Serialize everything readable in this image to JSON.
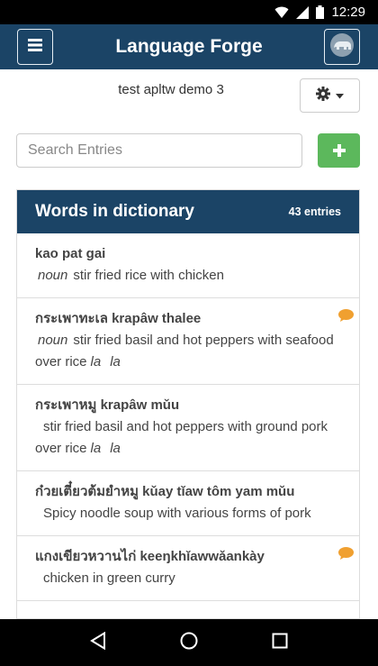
{
  "status_bar": {
    "time": "12:29"
  },
  "navbar": {
    "title": "Language Forge"
  },
  "project": {
    "name": "test apltw demo 3"
  },
  "search": {
    "placeholder": "Search Entries",
    "value": ""
  },
  "add_button": {
    "label": "+"
  },
  "list": {
    "heading": "Words in dictionary",
    "count": "43 entries",
    "entries": [
      {
        "word": "kao pat gai",
        "pos": "noun",
        "definition": "stir fried rice with chicken",
        "has_comment": false
      },
      {
        "word": "กระเพาทะเล krapâw thalee",
        "pos": "noun",
        "definition": "stir fried basil and hot peppers with seafood over rice",
        "extra1": "la",
        "extra2": "la",
        "has_comment": true
      },
      {
        "word": "กระเพาหมู krapâw mǔu",
        "pos": "",
        "definition": "stir fried basil and hot peppers with ground pork over rice",
        "extra1": "la",
        "extra2": "la",
        "has_comment": false
      },
      {
        "word": "ก๋วยเตี๋ยวต้มยำหมู kǔay tǐaw tôm yam mǔu",
        "pos": "",
        "definition": "Spicy noodle soup with various forms of pork",
        "has_comment": false
      },
      {
        "word": "แกงเขียวหวานไก่ keeŋkhǐawwǎankày",
        "pos": "",
        "definition": "chicken in green curry",
        "has_comment": true
      }
    ]
  },
  "colors": {
    "primary": "#1b4466",
    "success": "#5cb85c",
    "comment": "#f0a030"
  },
  "icons": [
    "wifi-icon",
    "signal-icon",
    "battery-icon",
    "menu-icon",
    "avatar-icon",
    "gear-icon",
    "caret-down-icon",
    "plus-icon",
    "comment-icon",
    "back-icon",
    "home-icon",
    "recents-icon"
  ]
}
